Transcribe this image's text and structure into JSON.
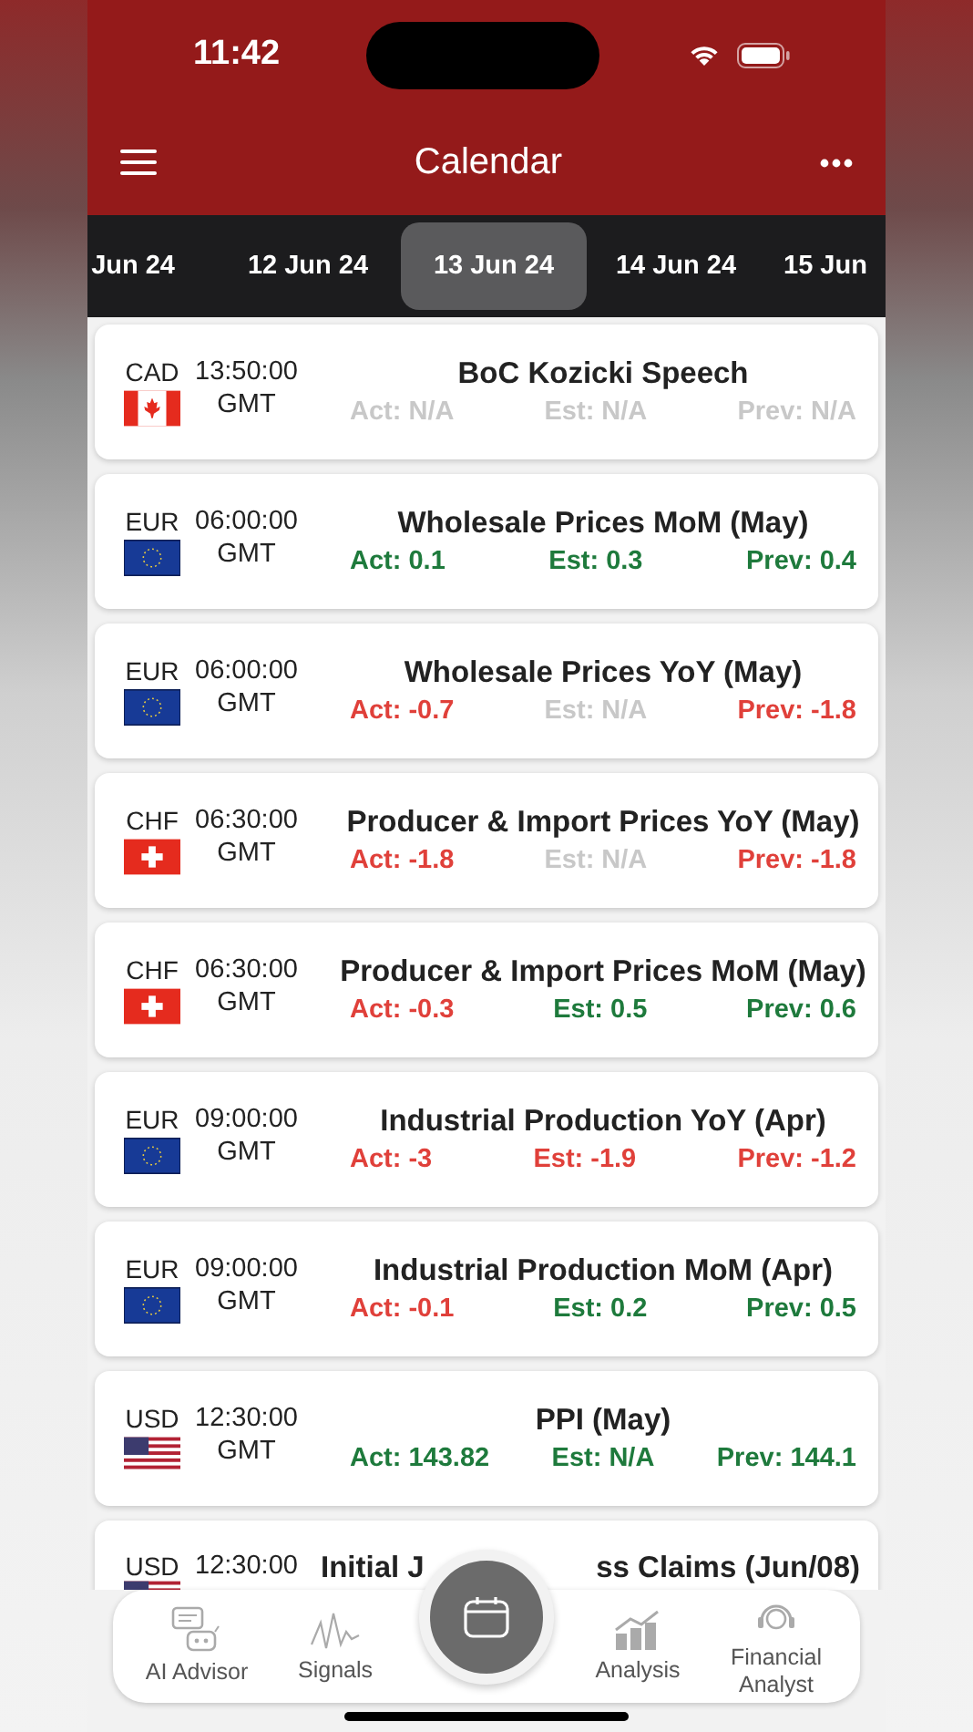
{
  "status_bar": {
    "time": "11:42"
  },
  "header": {
    "title": "Calendar"
  },
  "date_tabs": [
    {
      "label": "Jun 24",
      "selected": false
    },
    {
      "label": "12 Jun 24",
      "selected": false
    },
    {
      "label": "13 Jun 24",
      "selected": true
    },
    {
      "label": "14 Jun 24",
      "selected": false
    },
    {
      "label": "15 Jun",
      "selected": false
    }
  ],
  "events": [
    {
      "currency": "CAD",
      "kind": "canada",
      "time": "13:50:00",
      "zone": "GMT",
      "title": "BoC Kozicki Speech",
      "readings": [
        {
          "text": "Act: N/A",
          "color": "#c8c8c8"
        },
        {
          "text": "Est: N/A",
          "color": "#c8c8c8"
        },
        {
          "text": "Prev: N/A",
          "color": "#c8c8c8"
        }
      ]
    },
    {
      "currency": "EUR",
      "kind": "eu",
      "time": "06:00:00",
      "zone": "GMT",
      "title": "Wholesale Prices MoM (May)",
      "readings": [
        {
          "text": "Act: 0.1",
          "color": "#1e7a3c"
        },
        {
          "text": "Est: 0.3",
          "color": "#1e7a3c"
        },
        {
          "text": "Prev: 0.4",
          "color": "#1e7a3c"
        }
      ]
    },
    {
      "currency": "EUR",
      "kind": "eu",
      "time": "06:00:00",
      "zone": "GMT",
      "title": "Wholesale Prices YoY (May)",
      "readings": [
        {
          "text": "Act: -0.7",
          "color": "#e0403a"
        },
        {
          "text": "Est: N/A",
          "color": "#c8c8c8"
        },
        {
          "text": "Prev: -1.8",
          "color": "#e0403a"
        }
      ]
    },
    {
      "currency": "CHF",
      "kind": "swiss",
      "time": "06:30:00",
      "zone": "GMT",
      "title": "Producer & Import Prices YoY (May)",
      "readings": [
        {
          "text": "Act: -1.8",
          "color": "#e0403a"
        },
        {
          "text": "Est: N/A",
          "color": "#c8c8c8"
        },
        {
          "text": "Prev: -1.8",
          "color": "#e0403a"
        }
      ]
    },
    {
      "currency": "CHF",
      "kind": "swiss",
      "time": "06:30:00",
      "zone": "GMT",
      "title": "Producer & Import Prices MoM (May)",
      "readings": [
        {
          "text": "Act: -0.3",
          "color": "#e0403a"
        },
        {
          "text": "Est: 0.5",
          "color": "#1e7a3c"
        },
        {
          "text": "Prev: 0.6",
          "color": "#1e7a3c"
        }
      ]
    },
    {
      "currency": "EUR",
      "kind": "eu",
      "time": "09:00:00",
      "zone": "GMT",
      "title": "Industrial Production YoY (Apr)",
      "readings": [
        {
          "text": "Act: -3",
          "color": "#e0403a"
        },
        {
          "text": "Est: -1.9",
          "color": "#e0403a"
        },
        {
          "text": "Prev: -1.2",
          "color": "#e0403a"
        }
      ]
    },
    {
      "currency": "EUR",
      "kind": "eu",
      "time": "09:00:00",
      "zone": "GMT",
      "title": "Industrial Production MoM (Apr)",
      "readings": [
        {
          "text": "Act: -0.1",
          "color": "#e0403a"
        },
        {
          "text": "Est: 0.2",
          "color": "#1e7a3c"
        },
        {
          "text": "Prev: 0.5",
          "color": "#1e7a3c"
        }
      ]
    },
    {
      "currency": "USD",
      "kind": "us",
      "time": "12:30:00",
      "zone": "GMT",
      "title": "PPI (May)",
      "readings": [
        {
          "text": "Act: 143.82",
          "color": "#1e7a3c"
        },
        {
          "text": "Est: N/A",
          "color": "#1e7a3c"
        },
        {
          "text": "Prev: 144.1",
          "color": "#1e7a3c"
        }
      ]
    },
    {
      "currency": "USD",
      "kind": "us",
      "time": "12:30:00",
      "title_parts": [
        "Initial J",
        "ss Claims (Jun/08)"
      ]
    }
  ],
  "bottom_nav": [
    {
      "label": "AI Advisor",
      "kind": "robot"
    },
    {
      "label": "Signals",
      "kind": "signal"
    },
    {
      "kind": "calendar"
    },
    {
      "label": "Analysis",
      "kind": "chart"
    },
    {
      "label": "Financial Analyst",
      "kind": "headset"
    }
  ]
}
